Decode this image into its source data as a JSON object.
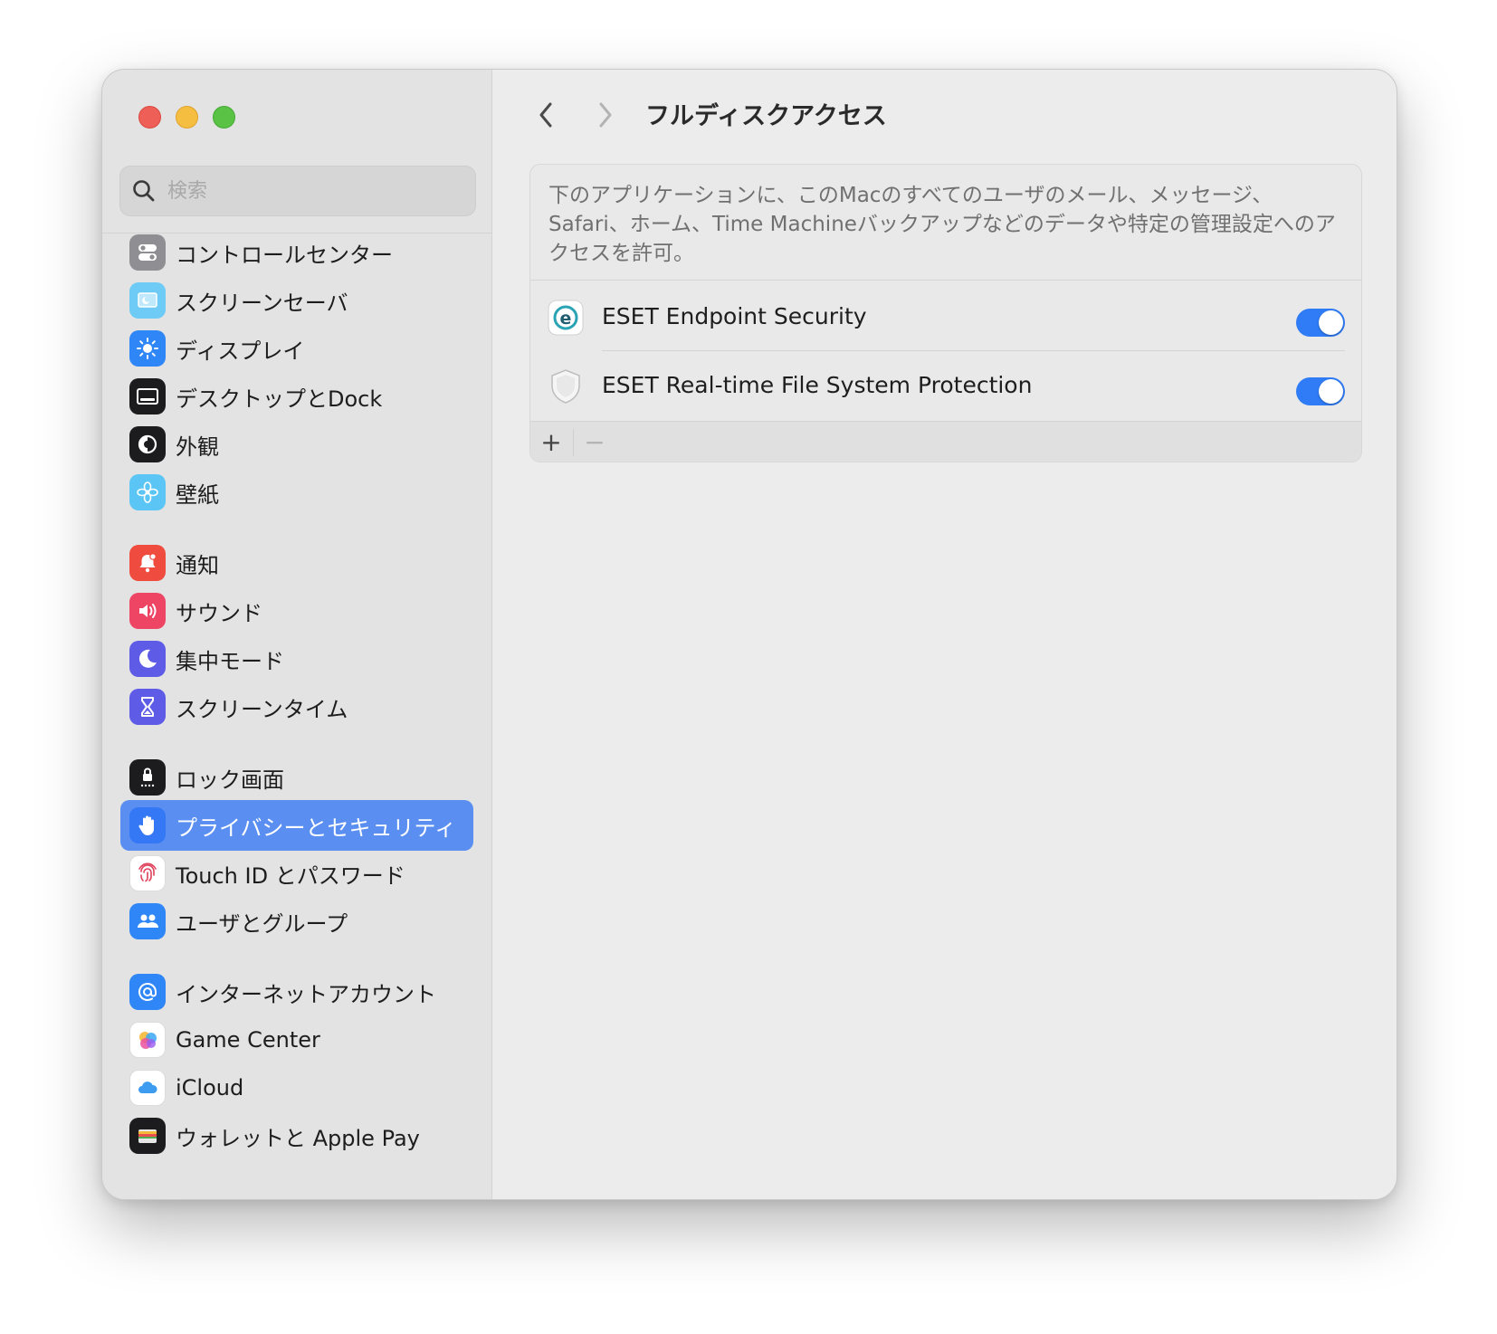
{
  "window": {
    "traffic_lights": [
      "close",
      "minimize",
      "zoom"
    ]
  },
  "search": {
    "placeholder": "検索",
    "icon": "magnifying-glass-icon"
  },
  "sidebar": {
    "items": [
      {
        "label": "コントロールセンター",
        "icon": "control-center-icon",
        "icon_bg": "#8e8e93"
      },
      {
        "label": "スクリーンセーバ",
        "icon": "screensaver-icon",
        "icon_bg": "#6ecbf5"
      },
      {
        "label": "ディスプレイ",
        "icon": "display-brightness-icon",
        "icon_bg": "#2f86f6"
      },
      {
        "label": "デスクトップとDock",
        "icon": "desktop-dock-icon",
        "icon_bg": "#1c1c1e"
      },
      {
        "label": "外観",
        "icon": "appearance-icon",
        "icon_bg": "#1c1c1e"
      },
      {
        "label": "壁紙",
        "icon": "wallpaper-flower-icon",
        "icon_bg": "#5bc6f5"
      },
      {
        "label": "通知",
        "icon": "notification-bell-icon",
        "icon_bg": "#ef4b3f"
      },
      {
        "label": "サウンド",
        "icon": "speaker-icon",
        "icon_bg": "#ef4565"
      },
      {
        "label": "集中モード",
        "icon": "moon-icon",
        "icon_bg": "#5e5ce6"
      },
      {
        "label": "スクリーンタイム",
        "icon": "hourglass-icon",
        "icon_bg": "#5e5ce6"
      },
      {
        "label": "ロック画面",
        "icon": "lock-screen-icon",
        "icon_bg": "#1c1c1e"
      },
      {
        "label": "プライバシーとセキュリティ",
        "icon": "hand-raised-icon",
        "icon_bg": "#3478f6",
        "active": true
      },
      {
        "label": "Touch ID とパスワード",
        "icon": "fingerprint-icon",
        "icon_bg": "#ffffff"
      },
      {
        "label": "ユーザとグループ",
        "icon": "users-icon",
        "icon_bg": "#2f86f6"
      },
      {
        "label": "インターネットアカウント",
        "icon": "at-sign-icon",
        "icon_bg": "#2f86f6"
      },
      {
        "label": "Game Center",
        "icon": "game-center-icon",
        "icon_bg": "#ffffff"
      },
      {
        "label": "iCloud",
        "icon": "icloud-icon",
        "icon_bg": "#ffffff"
      },
      {
        "label": "ウォレットと Apple Pay",
        "icon": "wallet-icon",
        "icon_bg": "#1c1c1e"
      }
    ]
  },
  "titlebar": {
    "back_icon": "chevron-left-icon",
    "forward_icon": "chevron-right-icon",
    "title": "フルディスクアクセス"
  },
  "panel": {
    "description": "下のアプリケーションに、このMacのすべてのユーザのメール、メッセージ、Safari、ホーム、Time Machineバックアップなどのデータや特定の管理設定へのアクセスを許可。",
    "apps": [
      {
        "name": "ESET Endpoint Security",
        "icon": "eset-endpoint-icon",
        "enabled": true
      },
      {
        "name": "ESET Real-time File System Protection",
        "icon": "shield-icon",
        "enabled": true
      }
    ],
    "add_label": "+",
    "remove_label": "−"
  },
  "colors": {
    "accent": "#2f7cf6",
    "sidebar_selected": "#5a8ff1"
  }
}
